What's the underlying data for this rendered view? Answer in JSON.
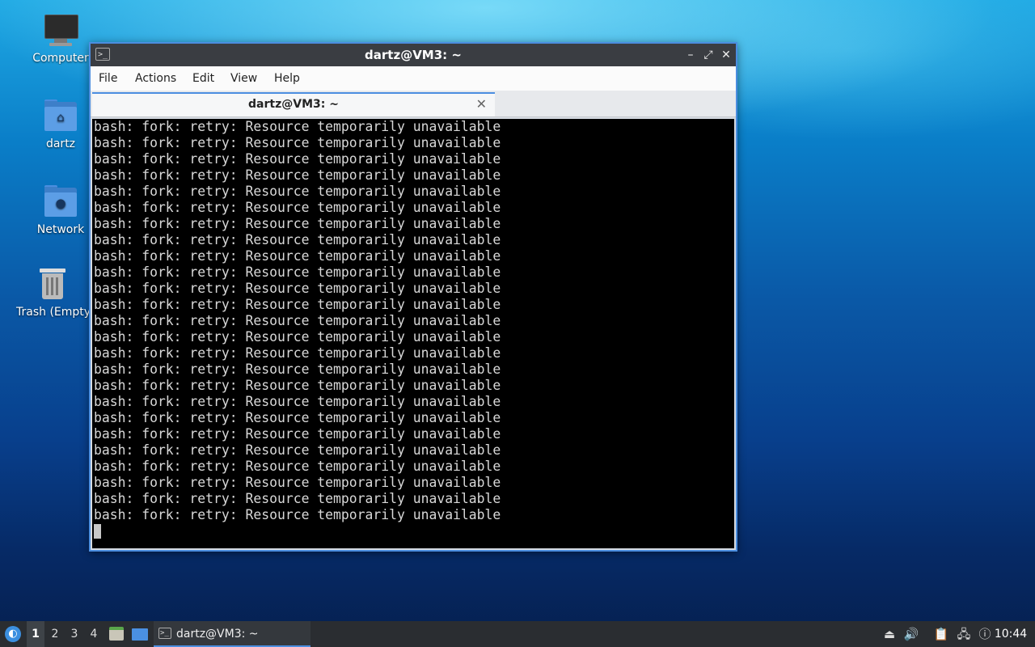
{
  "desktop": {
    "icons": [
      {
        "label": "Computer"
      },
      {
        "label": "dartz"
      },
      {
        "label": "Network"
      },
      {
        "label": "Trash (Empty)"
      }
    ]
  },
  "window": {
    "title": "dartz@VM3: ~",
    "controls": {
      "minimize": "–",
      "maximize": "⤢",
      "close": "✕"
    },
    "menu": [
      "File",
      "Actions",
      "Edit",
      "View",
      "Help"
    ],
    "tab": {
      "label": "dartz@VM3: ~",
      "close": "✕"
    },
    "terminal": {
      "lines": [
        "bash: fork: retry: Resource temporarily unavailable",
        "bash: fork: retry: Resource temporarily unavailable",
        "bash: fork: retry: Resource temporarily unavailable",
        "bash: fork: retry: Resource temporarily unavailable",
        "bash: fork: retry: Resource temporarily unavailable",
        "bash: fork: retry: Resource temporarily unavailable",
        "bash: fork: retry: Resource temporarily unavailable",
        "bash: fork: retry: Resource temporarily unavailable",
        "bash: fork: retry: Resource temporarily unavailable",
        "bash: fork: retry: Resource temporarily unavailable",
        "bash: fork: retry: Resource temporarily unavailable",
        "bash: fork: retry: Resource temporarily unavailable",
        "bash: fork: retry: Resource temporarily unavailable",
        "bash: fork: retry: Resource temporarily unavailable",
        "bash: fork: retry: Resource temporarily unavailable",
        "bash: fork: retry: Resource temporarily unavailable",
        "bash: fork: retry: Resource temporarily unavailable",
        "bash: fork: retry: Resource temporarily unavailable",
        "bash: fork: retry: Resource temporarily unavailable",
        "bash: fork: retry: Resource temporarily unavailable",
        "bash: fork: retry: Resource temporarily unavailable",
        "bash: fork: retry: Resource temporarily unavailable",
        "bash: fork: retry: Resource temporarily unavailable",
        "bash: fork: retry: Resource temporarily unavailable",
        "bash: fork: retry: Resource temporarily unavailable"
      ]
    }
  },
  "taskbar": {
    "workspaces": [
      "1",
      "2",
      "3",
      "4"
    ],
    "active_workspace": "1",
    "task_label": "dartz@VM3: ~",
    "clock": "10:44",
    "tray_icons": [
      "eject-icon",
      "volume-icon",
      "clipboard-icon",
      "network-icon",
      "update-notifier-icon"
    ]
  },
  "colors": {
    "accent": "#4b8ee0",
    "terminal_bg": "#000000",
    "terminal_fg": "#d8d8d8",
    "taskbar_bg": "#2a2d31"
  }
}
